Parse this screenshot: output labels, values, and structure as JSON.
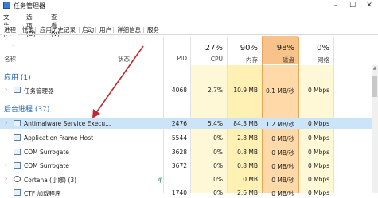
{
  "window": {
    "title": "任务管理器"
  },
  "window_controls": {
    "minimize": "–",
    "maximize": "☐",
    "close": "✕"
  },
  "menu": [
    "文件(F)",
    "选项(O)",
    "查看(V)"
  ],
  "tabs": [
    "进程",
    "性能",
    "应用历史记录",
    "启动",
    "用户",
    "详细信息",
    "服务"
  ],
  "active_tab": "进程",
  "columns": {
    "name": "名称",
    "status": "状态",
    "pid": "PID",
    "cpu": {
      "pct": "27%",
      "label": "CPU"
    },
    "memory": {
      "pct": "90%",
      "label": "内存"
    },
    "disk": {
      "pct": "98%",
      "label": "磁盘"
    },
    "network": {
      "pct": "0%",
      "label": "网络"
    }
  },
  "groups": {
    "apps": "应用 (1)",
    "background": "后台进程 (37)"
  },
  "rows": [
    {
      "name": "任务管理器",
      "pid": "4068",
      "cpu": "2.7%",
      "mem": "10.9 MB",
      "disk": "0.1 MB/秒",
      "net": "0 Mbps",
      "expand": true
    },
    {
      "name": "Antimalware Service Execu...",
      "pid": "2476",
      "cpu": "5.4%",
      "mem": "84.3 MB",
      "disk": "1.2 MB/秒",
      "net": "0 Mbps",
      "expand": true,
      "selected": true
    },
    {
      "name": "Application Frame Host",
      "pid": "5544",
      "cpu": "0%",
      "mem": "2.8 MB",
      "disk": "0 MB/秒",
      "net": "0 Mbps",
      "expand": false
    },
    {
      "name": "COM Surrogate",
      "pid": "3628",
      "cpu": "0%",
      "mem": "0.8 MB",
      "disk": "0 MB/秒",
      "net": "0 Mbps",
      "expand": false
    },
    {
      "name": "COM Surrogate",
      "pid": "3672",
      "cpu": "0%",
      "mem": "0.8 MB",
      "disk": "0 MB/秒",
      "net": "0 Mbps",
      "expand": true
    },
    {
      "name": "Cortana (小娜) (3)",
      "pid": "",
      "cpu": "0%",
      "mem": "0 MB",
      "disk": "0 MB/秒",
      "net": "0 Mbps",
      "expand": true
    },
    {
      "name": "CTF 加载程序",
      "pid": "1740",
      "cpu": "0%",
      "mem": "2.6 MB",
      "disk": "0 MB/秒",
      "net": "0 Mbps",
      "expand": false
    }
  ],
  "colors": {
    "cpu_tint": "#fff8d6",
    "mem_tint": "#fff0b3",
    "disk_tint": "#ffd9a8",
    "disk_header": "#f7c38a",
    "arrow": "#c0282d",
    "group_text": "#1a5fb4",
    "selected_row": "#cce4f7"
  }
}
